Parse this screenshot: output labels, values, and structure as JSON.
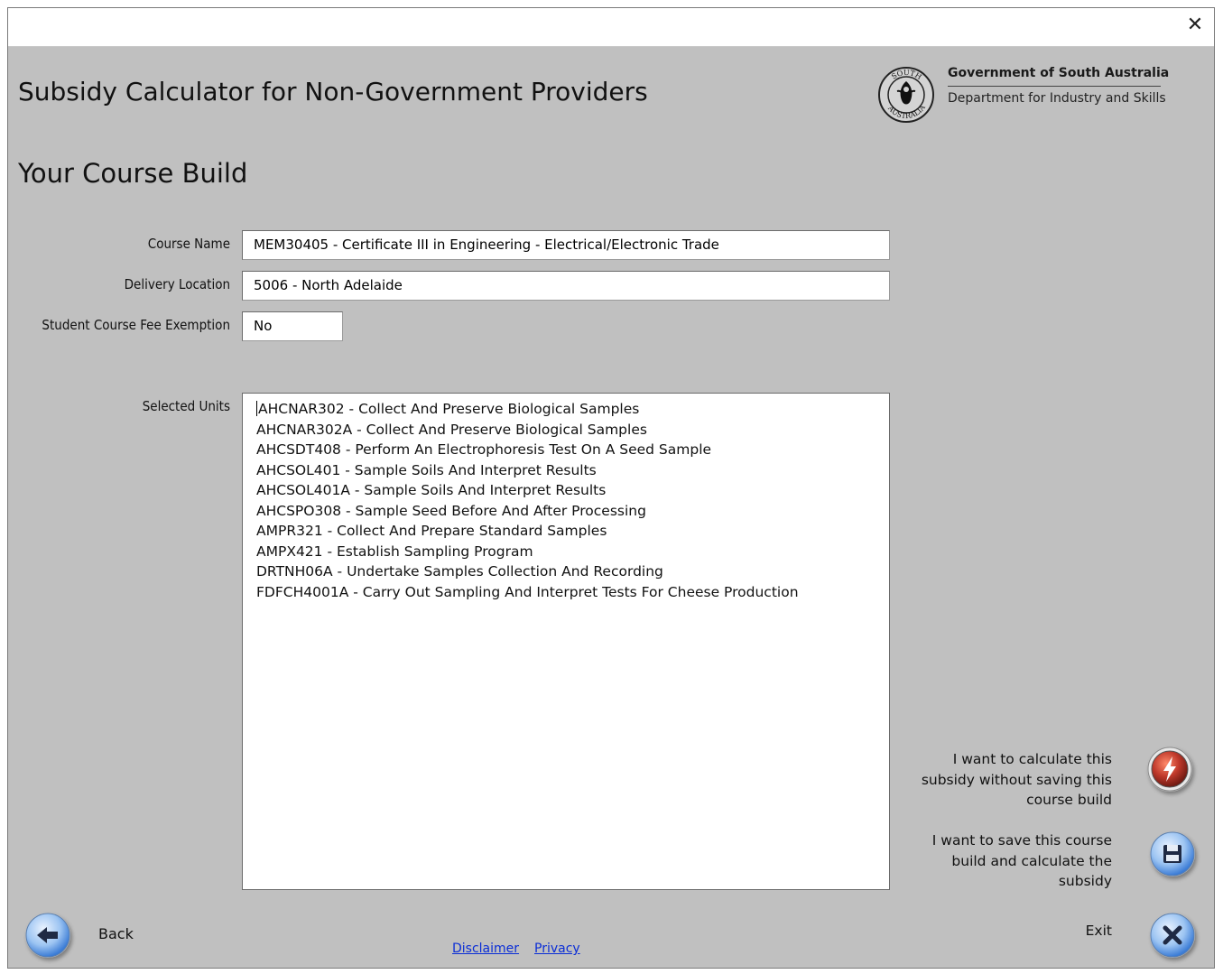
{
  "window": {
    "close_glyph": "✕"
  },
  "header": {
    "app_title": "Subsidy Calculator for Non-Government Providers",
    "section_title": "Your Course Build",
    "government_name": "Government of South Australia",
    "department_name": "Department for Industry and Skills",
    "seal_text": [
      "SOUTH",
      "AUSTRALIA"
    ]
  },
  "form": {
    "course_name_label": "Course Name",
    "course_name_value": "MEM30405  -  Certificate III in Engineering - Electrical/Electronic Trade",
    "delivery_location_label": "Delivery Location",
    "delivery_location_value": "5006  -  North Adelaide",
    "fee_exemption_label": "Student Course Fee Exemption",
    "fee_exemption_value": "No",
    "selected_units_label": "Selected Units"
  },
  "selected_units": [
    "AHCNAR302  -  Collect And Preserve Biological Samples",
    "AHCNAR302A  -  Collect And Preserve Biological Samples",
    "AHCSDT408  -  Perform An Electrophoresis Test On A Seed Sample",
    "AHCSOL401  -  Sample Soils And Interpret Results",
    "AHCSOL401A  -  Sample Soils And Interpret Results",
    "AHCSPO308  -  Sample Seed Before And After Processing",
    "AMPR321  -  Collect And Prepare Standard Samples",
    "AMPX421  -  Establish Sampling Program",
    "DRTNH06A  -  Undertake Samples Collection And Recording",
    "FDFCH4001A  -  Carry Out Sampling And Interpret Tests For Cheese Production"
  ],
  "actions": {
    "calculate_lines": [
      "I want to calculate this",
      "subsidy without saving this",
      "course build"
    ],
    "save_lines": [
      "I want to save this course",
      "build and calculate the",
      "subsidy"
    ],
    "exit_label": "Exit",
    "back_label": "Back"
  },
  "footer": {
    "disclaimer": "Disclaimer",
    "privacy": "Privacy"
  },
  "colors": {
    "background": "#c0c0c0",
    "link": "#0a2dd6",
    "button_blue": "#3a7bd5",
    "button_red": "#c0392b"
  },
  "icons": {
    "calculate": "lightning-bolt-icon",
    "save": "floppy-disk-icon",
    "exit": "x-icon",
    "back": "arrow-left-icon"
  }
}
